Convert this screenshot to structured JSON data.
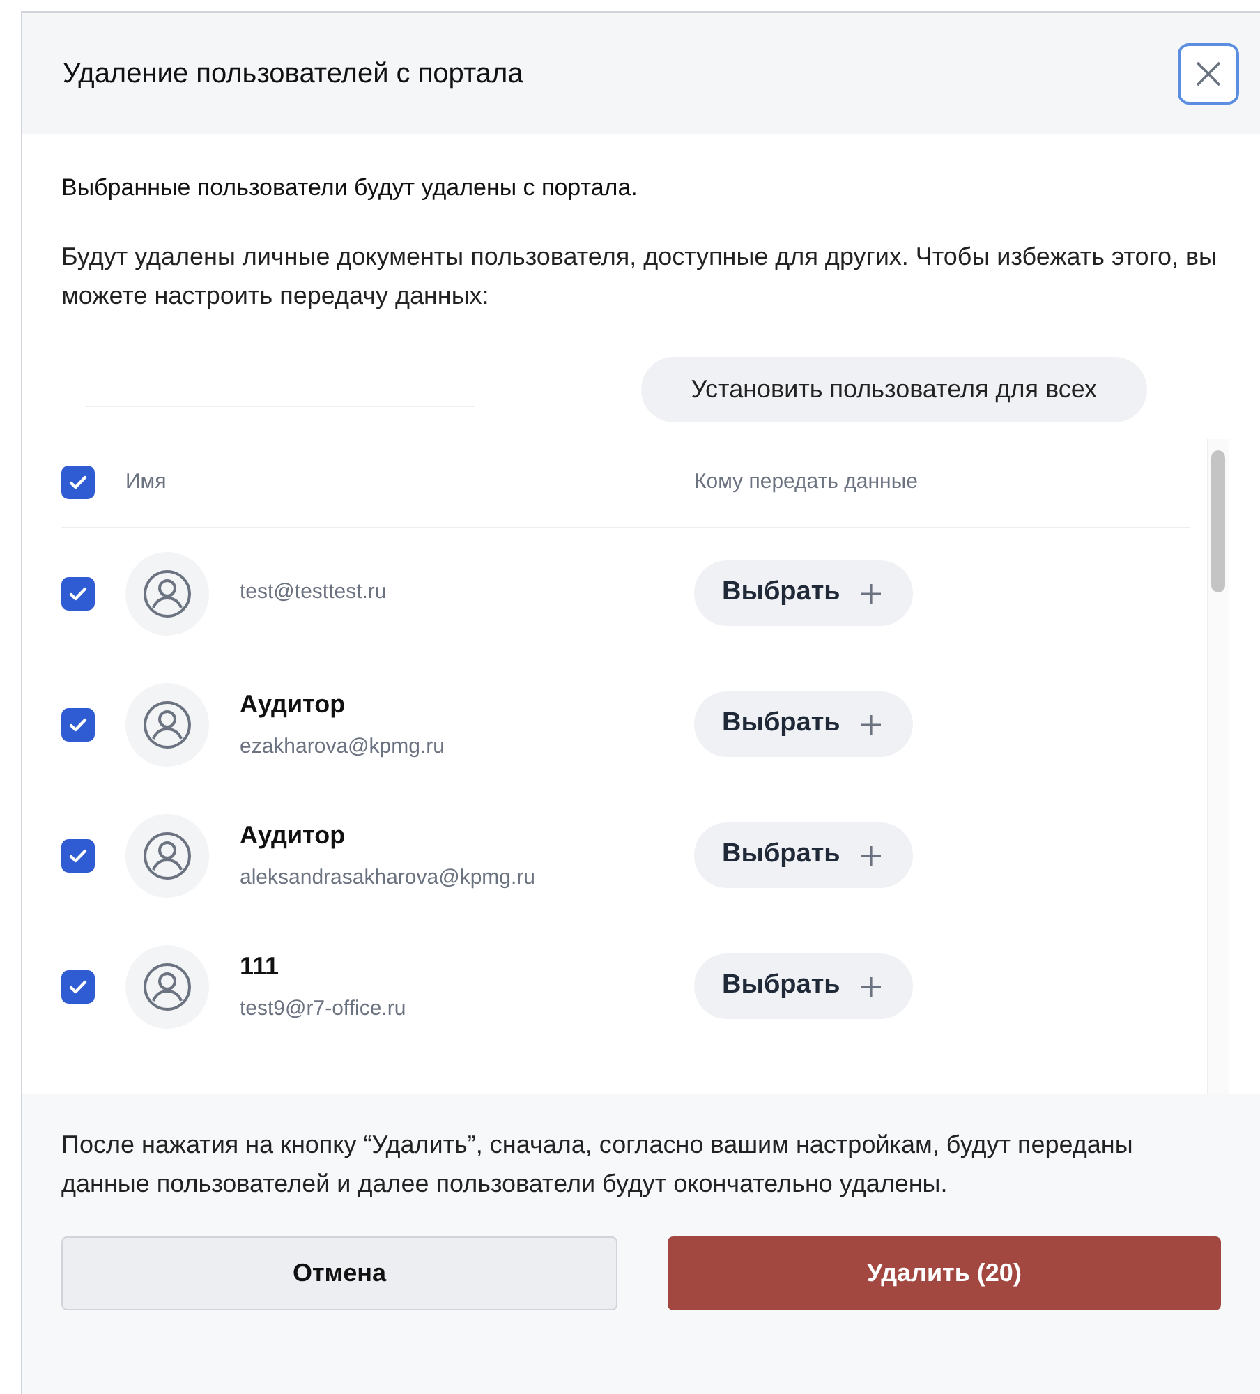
{
  "dialog": {
    "title": "Удаление пользователей с портала"
  },
  "intro": "Выбранные пользователи будут удалены с портала.",
  "description": "Будут удалены личные документы пользователя, доступные для других. Чтобы избежать этого, вы можете настроить передачу данных:",
  "set_all_button": "Установить пользователя для всех",
  "table": {
    "select_all_checked": true,
    "columns": [
      "Имя",
      "Кому передать данные"
    ],
    "rows": [
      {
        "name": "",
        "email": "test@testtest.ru",
        "checked": true,
        "action": "Выбрать"
      },
      {
        "name": "Аудитор",
        "email": "ezakharova@kpmg.ru",
        "checked": true,
        "action": "Выбрать"
      },
      {
        "name": "Аудитор",
        "email": "aleksandrasakharova@kpmg.ru",
        "checked": true,
        "action": "Выбрать"
      },
      {
        "name": "111",
        "email": "test9@r7-office.ru",
        "checked": true,
        "action": "Выбрать"
      }
    ]
  },
  "footer_note": "После нажатия на кнопку “Удалить”, сначала, согласно вашим настройкам, будут переданы данные пользователей и далее пользователи будут окончательно удалены.",
  "buttons": {
    "cancel": "Отмена",
    "delete": "Удалить (20)"
  }
}
